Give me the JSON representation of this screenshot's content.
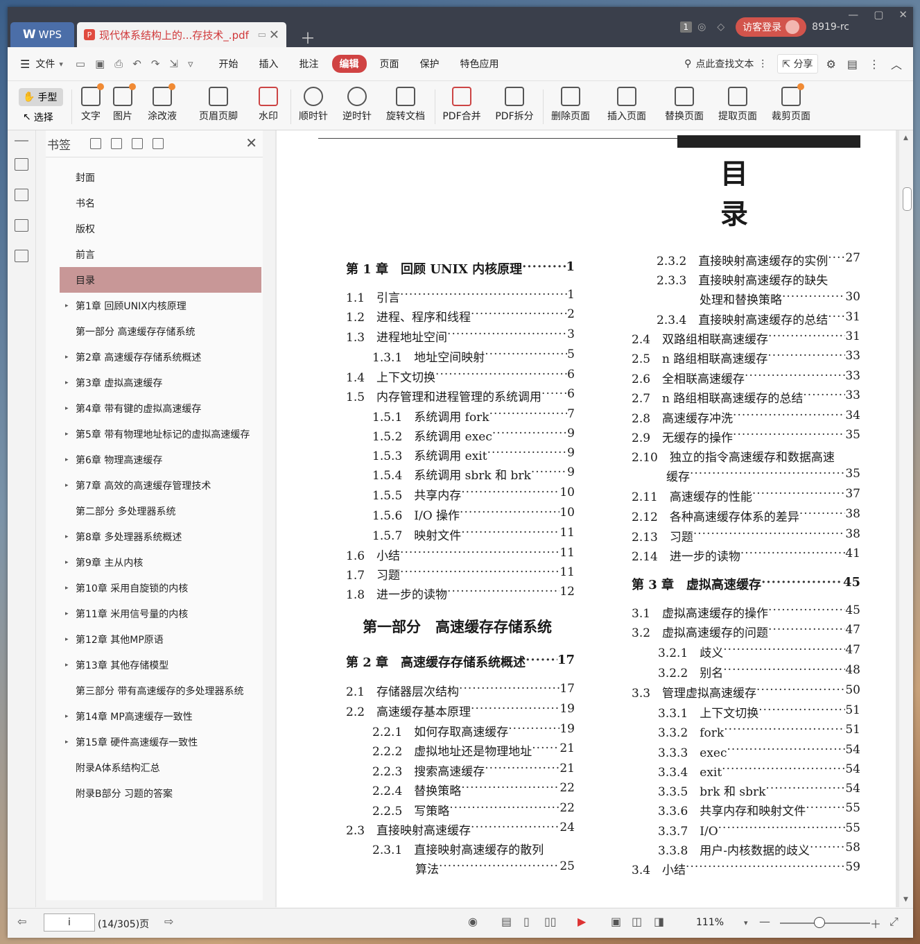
{
  "titlebar": {
    "app_tab": "WPS",
    "doc_tab": "现代体系结构上的...存技术_.pdf",
    "badge": "1",
    "login": "访客登录",
    "user": "8919-rc"
  },
  "menubar": {
    "file": "文件",
    "tabs": [
      "开始",
      "插入",
      "批注",
      "编辑",
      "页面",
      "保护",
      "特色应用"
    ],
    "active_tab": "编辑",
    "search": "点此查找文本",
    "share": "分享"
  },
  "ribbon": {
    "hand": "手型",
    "select": "选择",
    "buttons": [
      "文字",
      "图片",
      "涂改液",
      "页眉页脚",
      "水印",
      "顺时针",
      "逆时针",
      "旋转文档",
      "PDF合并",
      "PDF拆分",
      "删除页面",
      "插入页面",
      "替换页面",
      "提取页面",
      "裁剪页面"
    ]
  },
  "bookmarks": {
    "title": "书签",
    "items": [
      {
        "label": "封面",
        "arrow": false
      },
      {
        "label": "书名",
        "arrow": false
      },
      {
        "label": "版权",
        "arrow": false
      },
      {
        "label": "前言",
        "arrow": false
      },
      {
        "label": "目录",
        "arrow": false,
        "active": true
      },
      {
        "label": "第1章 回顾UNIX内核原理",
        "arrow": true
      },
      {
        "label": "第一部分 高速缓存存储系统",
        "arrow": false
      },
      {
        "label": "第2章 高速缓存存储系统概述",
        "arrow": true
      },
      {
        "label": "第3章 虚拟高速缓存",
        "arrow": true
      },
      {
        "label": "第4章 带有键的虚拟高速缓存",
        "arrow": true
      },
      {
        "label": "第5章 带有物理地址标记的虚拟高速缓存",
        "arrow": true
      },
      {
        "label": "第6章 物理高速缓存",
        "arrow": true
      },
      {
        "label": "第7章 高效的高速缓存管理技术",
        "arrow": true
      },
      {
        "label": "第二部分 多处理器系统",
        "arrow": false
      },
      {
        "label": "第8章 多处理器系统概述",
        "arrow": true
      },
      {
        "label": "第9章 主从内核",
        "arrow": true
      },
      {
        "label": "第10章 采用自旋锁的内核",
        "arrow": true
      },
      {
        "label": "第11章 米用信号量的内核",
        "arrow": true
      },
      {
        "label": "第12章 其他MP原语",
        "arrow": true
      },
      {
        "label": "第13章 其他存储模型",
        "arrow": true
      },
      {
        "label": "第三部分 带有高速缓存的多处理器系统",
        "arrow": false
      },
      {
        "label": "第14章 MP高速缓存一致性",
        "arrow": true
      },
      {
        "label": "第15章 硬件高速缓存一致性",
        "arrow": true
      },
      {
        "label": "附录A体系结构汇总",
        "arrow": false
      },
      {
        "label": "附录B部分 习题的答案",
        "arrow": false
      }
    ]
  },
  "page": {
    "heading": "目录",
    "left_column": [
      {
        "kind": "ch",
        "text": "第 1 章　回顾 UNIX 内核原理",
        "page": "1"
      },
      {
        "kind": "sec",
        "text": "1.1　引言",
        "page": "1"
      },
      {
        "kind": "sec",
        "text": "1.2　进程、程序和线程",
        "page": "2"
      },
      {
        "kind": "sec",
        "text": "1.3　进程地址空间",
        "page": "3"
      },
      {
        "kind": "sub",
        "text": "1.3.1　地址空间映射",
        "page": "5"
      },
      {
        "kind": "sec",
        "text": "1.4　上下文切换",
        "page": "6"
      },
      {
        "kind": "sec",
        "text": "1.5　内存管理和进程管理的系统调用",
        "page": "6"
      },
      {
        "kind": "sub",
        "text": "1.5.1　系统调用 fork",
        "page": "7"
      },
      {
        "kind": "sub",
        "text": "1.5.2　系统调用 exec",
        "page": "9"
      },
      {
        "kind": "sub",
        "text": "1.5.3　系统调用 exit",
        "page": "9"
      },
      {
        "kind": "sub",
        "text": "1.5.4　系统调用 sbrk 和 brk",
        "page": "9"
      },
      {
        "kind": "sub",
        "text": "1.5.5　共享内存",
        "page": "10"
      },
      {
        "kind": "sub",
        "text": "1.5.6　I/O 操作",
        "page": "10"
      },
      {
        "kind": "sub",
        "text": "1.5.7　映射文件",
        "page": "11"
      },
      {
        "kind": "sec",
        "text": "1.6　小结",
        "page": "11"
      },
      {
        "kind": "sec",
        "text": "1.7　习题",
        "page": "11"
      },
      {
        "kind": "sec",
        "text": "1.8　进一步的读物",
        "page": "12"
      },
      {
        "kind": "part",
        "text": "第一部分　高速缓存存储系统",
        "page": ""
      },
      {
        "kind": "ch",
        "text": "第 2 章　高速缓存存储系统概述",
        "page": "17"
      },
      {
        "kind": "sec",
        "text": "2.1　存储器层次结构",
        "page": "17"
      },
      {
        "kind": "sec",
        "text": "2.2　高速缓存基本原理",
        "page": "19"
      },
      {
        "kind": "sub",
        "text": "2.2.1　如何存取高速缓存",
        "page": "19"
      },
      {
        "kind": "sub",
        "text": "2.2.2　虚拟地址还是物理地址",
        "page": "21"
      },
      {
        "kind": "sub",
        "text": "2.2.3　搜索高速缓存",
        "page": "21"
      },
      {
        "kind": "sub",
        "text": "2.2.4　替换策略",
        "page": "22"
      },
      {
        "kind": "sub",
        "text": "2.2.5　写策略",
        "page": "22"
      },
      {
        "kind": "sec",
        "text": "2.3　直接映射高速缓存",
        "page": "24"
      },
      {
        "kind": "sub",
        "text": "2.3.1　直接映射高速缓存的散列",
        "page": ""
      },
      {
        "kind": "cont",
        "text": "算法",
        "page": "25"
      }
    ],
    "right_column": [
      {
        "kind": "sub",
        "text": "2.3.2　直接映射高速缓存的实例",
        "page": "27"
      },
      {
        "kind": "sub",
        "text": "2.3.3　直接映射高速缓存的缺失",
        "page": ""
      },
      {
        "kind": "cont",
        "text": "处理和替换策略",
        "page": "30"
      },
      {
        "kind": "sub",
        "text": "2.3.4　直接映射高速缓存的总结",
        "page": "31"
      },
      {
        "kind": "sec",
        "text": "2.4　双路组相联高速缓存",
        "page": "31"
      },
      {
        "kind": "sec",
        "text": "2.5　n 路组相联高速缓存",
        "page": "33"
      },
      {
        "kind": "sec",
        "text": "2.6　全相联高速缓存",
        "page": "33"
      },
      {
        "kind": "sec",
        "text": "2.7　n 路组相联高速缓存的总结",
        "page": "33"
      },
      {
        "kind": "sec",
        "text": "2.8　高速缓存冲洗",
        "page": "34"
      },
      {
        "kind": "sec",
        "text": "2.9　无缓存的操作",
        "page": "35"
      },
      {
        "kind": "sec",
        "text": "2.10　独立的指令高速缓存和数据高速",
        "page": ""
      },
      {
        "kind": "cont",
        "text": "缓存",
        "page": "35"
      },
      {
        "kind": "sec",
        "text": "2.11　高速缓存的性能",
        "page": "37"
      },
      {
        "kind": "sec",
        "text": "2.12　各种高速缓存体系的差异",
        "page": "38"
      },
      {
        "kind": "sec",
        "text": "2.13　习题",
        "page": "38"
      },
      {
        "kind": "sec",
        "text": "2.14　进一步的读物",
        "page": "41"
      },
      {
        "kind": "ch",
        "text": "第 3 章　虚拟高速缓存",
        "page": "45"
      },
      {
        "kind": "sec",
        "text": "3.1　虚拟高速缓存的操作",
        "page": "45"
      },
      {
        "kind": "sec",
        "text": "3.2　虚拟高速缓存的问题",
        "page": "47"
      },
      {
        "kind": "sub",
        "text": "3.2.1　歧义",
        "page": "47"
      },
      {
        "kind": "sub",
        "text": "3.2.2　别名",
        "page": "48"
      },
      {
        "kind": "sec",
        "text": "3.3　管理虚拟高速缓存",
        "page": "50"
      },
      {
        "kind": "sub",
        "text": "3.3.1　上下文切换",
        "page": "51"
      },
      {
        "kind": "sub",
        "text": "3.3.2　fork",
        "page": "51"
      },
      {
        "kind": "sub",
        "text": "3.3.3　exec",
        "page": "54"
      },
      {
        "kind": "sub",
        "text": "3.3.4　exit",
        "page": "54"
      },
      {
        "kind": "sub",
        "text": "3.3.5　brk 和 sbrk",
        "page": "54"
      },
      {
        "kind": "sub",
        "text": "3.3.6　共享内存和映射文件",
        "page": "55"
      },
      {
        "kind": "sub",
        "text": "3.3.7　I/O",
        "page": "55"
      },
      {
        "kind": "sub",
        "text": "3.3.8　用户-内核数据的歧义",
        "page": "58"
      },
      {
        "kind": "sec",
        "text": "3.4　小结",
        "page": "59"
      }
    ]
  },
  "statusbar": {
    "page_input": "i",
    "page_info": "(14/305)页",
    "zoom": "111%"
  }
}
